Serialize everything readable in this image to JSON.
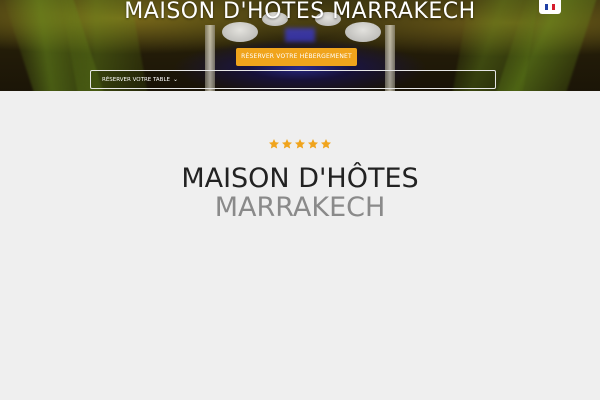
{
  "hero": {
    "title": "MAISON D'HÔTES MARRAKECH",
    "booking_button": "RÉSERVER VOTRE HÉBERGEMENET",
    "table_dropdown": "RÉSERVER VOTRE TABLE"
  },
  "language": {
    "flag": "french-flag",
    "colors": [
      "#1f3fa6",
      "#ffffff",
      "#d61c2c"
    ]
  },
  "rating": {
    "stars": 5,
    "color": "#f0a41c"
  },
  "main": {
    "title": "MAISON D'HÔTES",
    "subtitle": "MARRAKECH"
  },
  "theme": {
    "accent": "#f0a41c",
    "background": "#efefef"
  }
}
